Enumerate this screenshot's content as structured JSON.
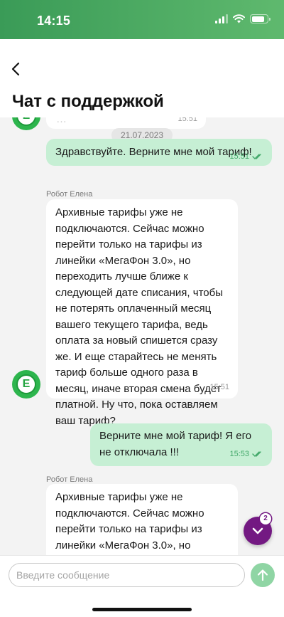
{
  "status_bar": {
    "time": "14:15",
    "battery_level": 0.85
  },
  "header": {
    "title": "Чат с поддержкой"
  },
  "messages": [
    {
      "type": "incoming",
      "text": "…",
      "time": "15:51"
    },
    {
      "type": "date",
      "text": "21.07.2023"
    },
    {
      "type": "outgoing",
      "text": "Здравствуйте. Верните мне мой тариф!",
      "time": "15:51"
    },
    {
      "type": "incoming",
      "sender": "Робот Елена",
      "avatar_letter": "E",
      "text": "Архивные тарифы уже не подключаются. Сейчас можно перейти только на тарифы из линейки «МегаФон 3.0», но переходить лучше ближе к следующей дате списания, чтобы не потерять оплаченный месяц вашего текущего тарифа, ведь оплата за новый спишется сразу же. И еще старайтесь не менять тариф больше одного раза в месяц, иначе вторая смена будет платной. Ну что, пока оставляем ваш тариф?",
      "time": "15:51"
    },
    {
      "type": "outgoing",
      "text": "Верните мне мой тариф! Я его не отключала !!!",
      "time": "15:53"
    },
    {
      "type": "incoming",
      "sender": "Робот Елена",
      "text": "Архивные тарифы уже не подключаются. Сейчас можно перейти только на тарифы из линейки «МегаФон 3.0», но переходить лучше ближе к"
    }
  ],
  "scroll_button": {
    "unread_count": "2"
  },
  "composer": {
    "placeholder": "Введите сообщение"
  },
  "colors": {
    "brand_green": "#00b956",
    "brand_purple": "#731982",
    "outgoing_bubble": "#c6efd4"
  }
}
